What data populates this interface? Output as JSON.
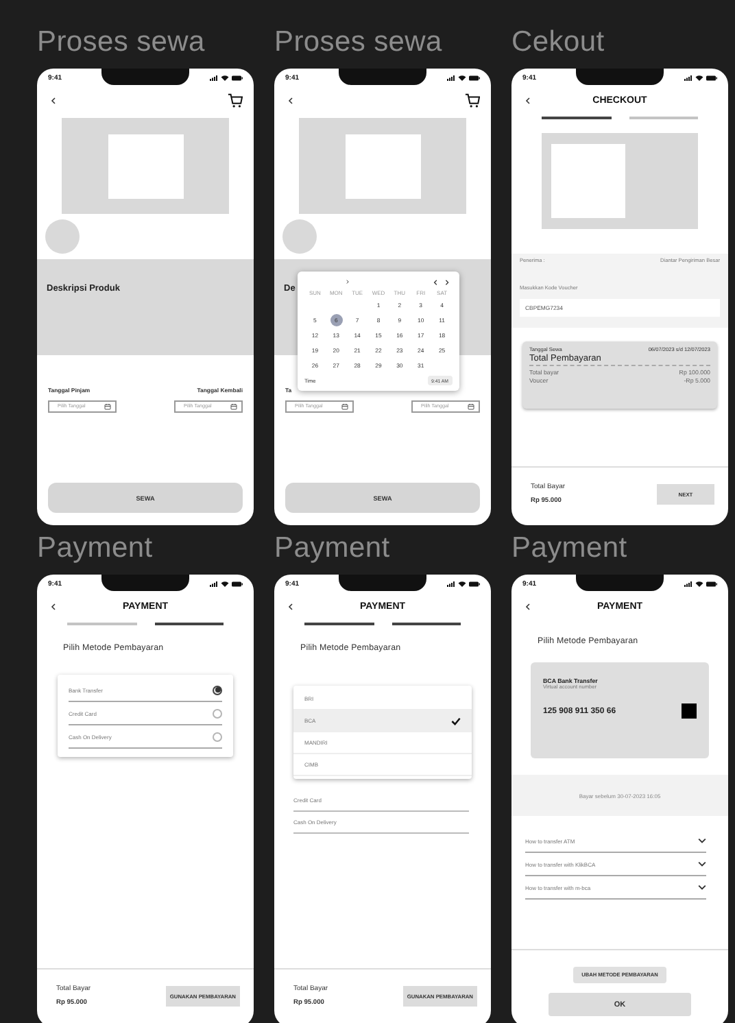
{
  "screens": [
    {
      "label": "Proses sewa",
      "time": "9:41",
      "header": {
        "kind": "cart"
      },
      "sections": [
        {
          "kind": "image_center"
        },
        {
          "kind": "avatar"
        },
        {
          "kind": "description",
          "title": "Deskripsi Produk"
        },
        {
          "kind": "dates",
          "items": [
            {
              "label": "Tanggal Pinjam",
              "placeholder": "Pilih Tanggal"
            },
            {
              "label": "Tanggal Kembali",
              "placeholder": "Pilih Tanggal"
            }
          ]
        }
      ],
      "footer": {
        "kind": "button",
        "label": "SEWA"
      }
    },
    {
      "label": "Proses sewa",
      "time": "9:41",
      "header": {
        "kind": "cart"
      },
      "sections": [
        {
          "kind": "image_center"
        },
        {
          "kind": "avatar"
        },
        {
          "kind": "description",
          "title": "De"
        },
        {
          "kind": "dates",
          "items": [
            {
              "label": "Ta",
              "placeholder": "Pilih Tanggal"
            },
            {
              "placeholder": "Pilih Tanggal"
            }
          ]
        }
      ],
      "calendar": {
        "weekdays": [
          "SUN",
          "MON",
          "TUE",
          "WED",
          "THU",
          "FRI",
          "SAT"
        ],
        "weeks": [
          {
            "kind": "first",
            "days": [
              {
                "day": "1",
                "selected": false
              },
              {
                "day": "2",
                "selected": false
              },
              {
                "day": "3",
                "selected": false
              },
              {
                "day": "4",
                "selected": false
              }
            ]
          },
          {
            "kind": "full",
            "days": [
              {
                "day": "5",
                "selected": false
              },
              {
                "day": "6",
                "selected": true
              },
              {
                "day": "7",
                "selected": false
              },
              {
                "day": "8",
                "selected": false
              },
              {
                "day": "9",
                "selected": false
              },
              {
                "day": "10",
                "selected": false
              },
              {
                "day": "11",
                "selected": false
              }
            ]
          },
          {
            "kind": "full",
            "days": [
              {
                "day": "12",
                "selected": false
              },
              {
                "day": "13",
                "selected": false
              },
              {
                "day": "14",
                "selected": false
              },
              {
                "day": "15",
                "selected": false
              },
              {
                "day": "16",
                "selected": false
              },
              {
                "day": "17",
                "selected": false
              },
              {
                "day": "18",
                "selected": false
              }
            ]
          },
          {
            "kind": "full",
            "days": [
              {
                "day": "19",
                "selected": false
              },
              {
                "day": "20",
                "selected": false
              },
              {
                "day": "21",
                "selected": false
              },
              {
                "day": "22",
                "selected": false
              },
              {
                "day": "23",
                "selected": false
              },
              {
                "day": "24",
                "selected": false
              },
              {
                "day": "25",
                "selected": false
              }
            ]
          },
          {
            "kind": "last",
            "days": [
              {
                "day": "26",
                "selected": false
              },
              {
                "day": "27",
                "selected": false
              },
              {
                "day": "28",
                "selected": false
              },
              {
                "day": "29",
                "selected": false
              },
              {
                "day": "30",
                "selected": false
              },
              {
                "day": "31",
                "selected": false
              }
            ]
          }
        ],
        "time_label": "Time",
        "time_value": "9:41 AM"
      },
      "footer": {
        "kind": "button",
        "label": "SEWA"
      }
    },
    {
      "label": "Cekout",
      "time": "9:41",
      "header": {
        "kind": "titled",
        "title": "CHECKOUT"
      },
      "sections": [
        {
          "kind": "tabs",
          "items": [
            {
              "selected": true
            },
            {
              "selected": false
            }
          ]
        },
        {
          "kind": "image_left"
        },
        {
          "kind": "info_row",
          "left": "Penerima :",
          "right": "Diantar Pengiriman Besar"
        },
        {
          "kind": "voucher",
          "label": "Masukkan Kode Voucher",
          "value": "CBPEMG7234"
        },
        {
          "kind": "summary",
          "date_label": "Tanggal Sewa",
          "date_value": "06/07/2023 s/d 12/07/2023",
          "title": "Total Pembayaran",
          "lines": [
            {
              "label": "Total bayar",
              "value": "Rp 100.000"
            },
            {
              "label": "Voucer",
              "value": "-Rp 5.000"
            }
          ]
        }
      ],
      "footer": {
        "kind": "total",
        "label": "Total Bayar",
        "value": "Rp 95.000",
        "button": "NEXT"
      }
    },
    {
      "label": "Payment",
      "time": "9:41",
      "header": {
        "kind": "titled",
        "title": "PAYMENT"
      },
      "sections": [
        {
          "kind": "tabs",
          "items": [
            {
              "selected": false
            },
            {
              "selected": true
            }
          ]
        },
        {
          "kind": "heading",
          "text": "Pilih Metode Pembayaran"
        },
        {
          "kind": "methods",
          "items": [
            {
              "label": "Bank Transfer",
              "selected": true
            },
            {
              "label": "Credit Card",
              "selected": false
            },
            {
              "label": "Cash On Delivery",
              "selected": false
            }
          ]
        }
      ],
      "footer": {
        "kind": "total",
        "label": "Total Bayar",
        "value": "Rp 95.000",
        "button": "GUNAKAN PEMBAYARAN"
      }
    },
    {
      "label": "Payment",
      "time": "9:41",
      "header": {
        "kind": "titled",
        "title": "PAYMENT"
      },
      "sections": [
        {
          "kind": "tabs",
          "items": [
            {
              "selected": true
            },
            {
              "selected": true
            }
          ]
        },
        {
          "kind": "heading",
          "text": "Pilih Metode Pembayaran"
        },
        {
          "kind": "banks",
          "items": [
            {
              "label": "BRI",
              "selected": false
            },
            {
              "label": "BCA",
              "selected": true
            },
            {
              "label": "MANDIRI",
              "selected": false
            },
            {
              "label": "CIMB",
              "selected": false
            }
          ]
        },
        {
          "kind": "options",
          "items": [
            "Credit Card",
            "Cash On Delivery"
          ]
        }
      ],
      "footer": {
        "kind": "total",
        "label": "Total Bayar",
        "value": "Rp 95.000",
        "button": "GUNAKAN PEMBAYARAN"
      }
    },
    {
      "label": "Payment",
      "time": "9:41",
      "header": {
        "kind": "titled",
        "title": "PAYMENT"
      },
      "sections": [
        {
          "kind": "heading",
          "text": "Pilih Metode Pembayaran"
        },
        {
          "kind": "va_card",
          "title": "BCA Bank Transfer",
          "subtitle": "Virtual account number",
          "number": "125 908 911 350 66"
        },
        {
          "kind": "notice",
          "text": "Bayar sebelum 30-07-2023 16:05"
        },
        {
          "kind": "accordion",
          "items": [
            "How to transfer ATM",
            "How to transfer with KlikBCA",
            "How to transfer with m-bca"
          ]
        }
      ],
      "footer": {
        "kind": "buttons",
        "items": [
          {
            "label": "UBAH METODE PEMBAYARAN",
            "kind": "secondary"
          },
          {
            "label": "OK",
            "kind": "primary"
          }
        ]
      }
    }
  ]
}
